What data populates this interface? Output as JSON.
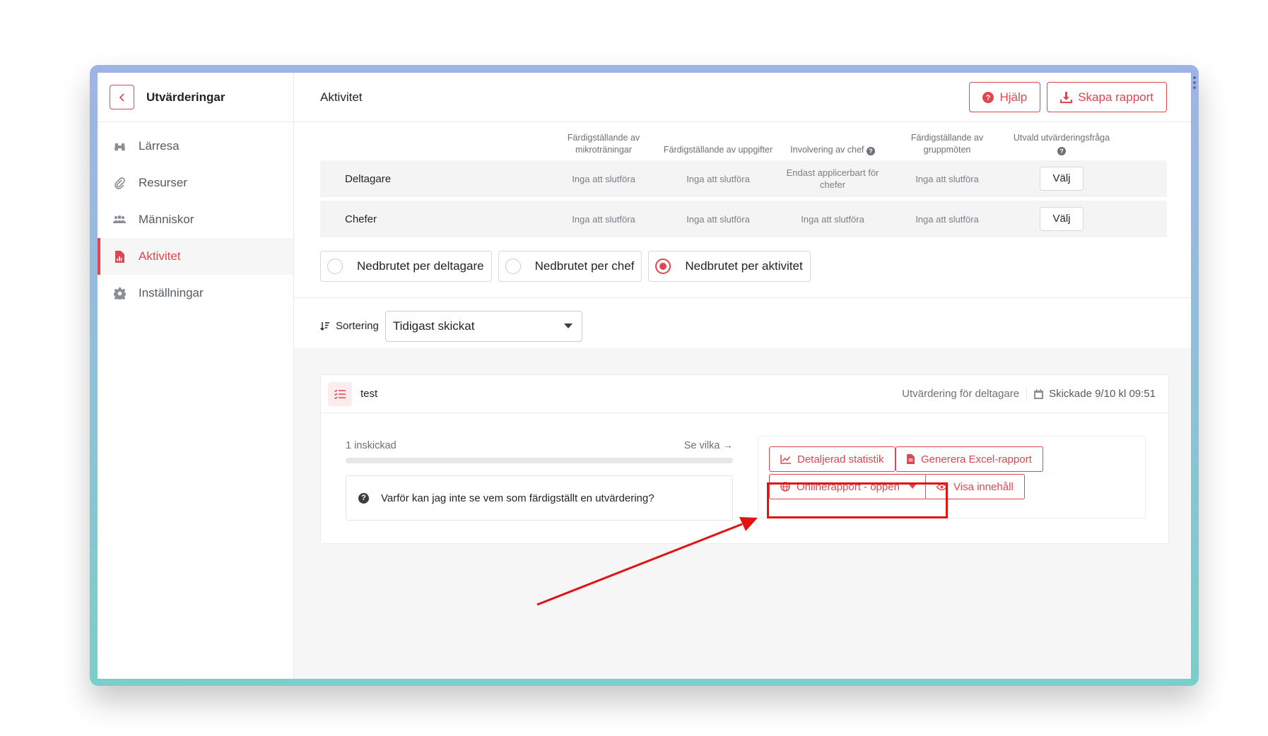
{
  "sidebar": {
    "title": "Utvärderingar",
    "items": [
      {
        "label": "Lärresa",
        "icon": "binoculars-icon",
        "active": false
      },
      {
        "label": "Resurser",
        "icon": "paperclip-icon",
        "active": false
      },
      {
        "label": "Människor",
        "icon": "users-icon",
        "active": false
      },
      {
        "label": "Aktivitet",
        "icon": "report-file-icon",
        "active": true
      },
      {
        "label": "Inställningar",
        "icon": "gear-icon",
        "active": false
      }
    ]
  },
  "header": {
    "title": "Aktivitet",
    "help_label": "Hjälp",
    "create_report_label": "Skapa rapport"
  },
  "table": {
    "columns": [
      "Färdigställande av mikroträningar",
      "Färdigställande av uppgifter",
      "Involvering av chef",
      "Färdigställande av gruppmöten",
      "Utvald utvärderingsfråga"
    ],
    "rows": [
      {
        "name": "Deltagare",
        "cells": [
          "Inga att slutföra",
          "Inga att slutföra",
          "Endast applicerbart för chefer",
          "Inga att slutföra"
        ],
        "action": "Välj"
      },
      {
        "name": "Chefer",
        "cells": [
          "Inga att slutföra",
          "Inga att slutföra",
          "Inga att slutföra",
          "Inga att slutföra"
        ],
        "action": "Välj"
      }
    ]
  },
  "view_options": [
    {
      "label": "Nedbrutet per deltagare",
      "selected": false
    },
    {
      "label": "Nedbrutet per chef",
      "selected": false
    },
    {
      "label": "Nedbrutet per aktivitet",
      "selected": true
    }
  ],
  "sort": {
    "label": "Sortering",
    "value": "Tidigast skickat"
  },
  "card": {
    "title": "test",
    "type": "Utvärdering för deltagare",
    "sent": "Skickade 9/10 kl 09:51",
    "submitted": "1 inskickad",
    "see_which": "Se vilka →",
    "progress": 0,
    "info_question": "Varför kan jag inte se vem som färdigställt en utvärdering?",
    "actions": {
      "stats": "Detaljerad statistik",
      "excel": "Generera Excel-rapport",
      "online": "Onlinerapport - öppen",
      "show": "Visa innehåll"
    }
  },
  "colors": {
    "accent": "#e04550",
    "annotation": "#e11414"
  }
}
